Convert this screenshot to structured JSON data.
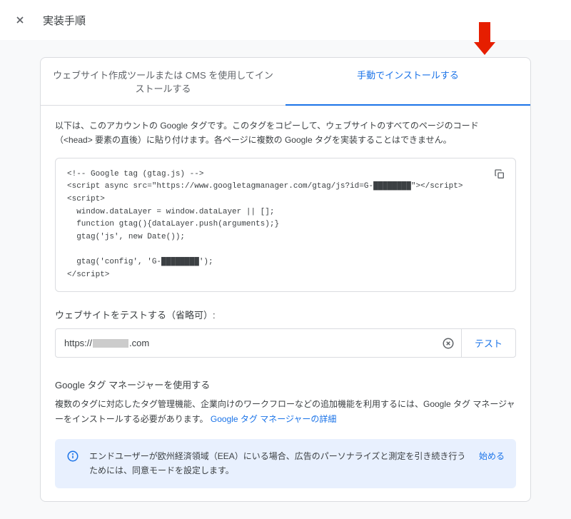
{
  "header": {
    "title": "実装手順"
  },
  "tabs": {
    "cms": "ウェブサイト作成ツールまたは CMS を使用してインストールする",
    "manual": "手動でインストールする"
  },
  "main": {
    "description": "以下は、このアカウントの Google タグです。このタグをコピーして、ウェブサイトのすべてのページのコード（<head> 要素の直後）に貼り付けます。各ページに複数の Google タグを実装することはできません。",
    "code": "<!-- Google tag (gtag.js) -->\n<script async src=\"https://www.googletagmanager.com/gtag/js?id=G-████████\"></script>\n<script>\n  window.dataLayer = window.dataLayer || [];\n  function gtag(){dataLayer.push(arguments);}\n  gtag('js', new Date());\n\n  gtag('config', 'G-████████');\n</script>"
  },
  "test": {
    "title": "ウェブサイトをテストする（省略可）:",
    "url_prefix": "https://",
    "url_suffix": ".com",
    "button": "テスト"
  },
  "gtm": {
    "title": "Google タグ マネージャーを使用する",
    "description": "複数のタグに対応したタグ管理機能、企業向けのワークフローなどの追加機能を利用するには、Google タグ マネージャーをインストールする必要があります。",
    "link": "Google タグ マネージャーの詳細"
  },
  "banner": {
    "text": "エンドユーザーが欧州経済領域（EEA）にいる場合、広告のパーソナライズと測定を引き続き行うためには、同意モードを設定します。",
    "action": "始める"
  }
}
